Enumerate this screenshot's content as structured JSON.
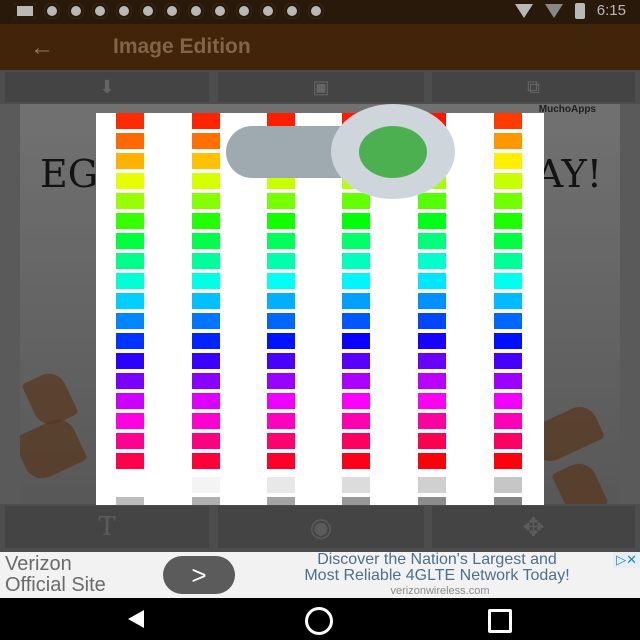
{
  "status": {
    "time": "6:15"
  },
  "appbar": {
    "title": "Image Edition"
  },
  "toolbar_top": {
    "buttons": [
      "download-icon",
      "image-add-icon",
      "share-icon"
    ]
  },
  "photo": {
    "watermark": "MuchoApps",
    "text_left": "EGG",
    "text_right": "AY!"
  },
  "toolbar_bottom": {
    "buttons": [
      "text-icon",
      "palette-icon",
      "move-icon"
    ]
  },
  "ad": {
    "title_line1": "Verizon",
    "title_line2": "Official Site",
    "arrow": ">",
    "text_line1": "Discover the Nation's Largest and",
    "text_line2": "Most Reliable 4GLTE Network Today!",
    "url": "verizonwireless.com",
    "adchoices": "▷✕"
  },
  "palette": {
    "columns": [
      [
        "#ff2b00",
        "#ff6a00",
        "#ffb300",
        "#e6ff00",
        "#98ff00",
        "#35ff00",
        "#00ff3c",
        "#00ff8a",
        "#00ffd5",
        "#00cfff",
        "#0086ff",
        "#0033ff",
        "#2a00ff",
        "#7a00ff",
        "#cc00ff",
        "#ff00e0",
        "#ff0090",
        "#ff004a"
      ],
      [
        "#ff2400",
        "#ff7000",
        "#ffc200",
        "#d6ff00",
        "#86ff00",
        "#23ff00",
        "#00ff4a",
        "#00ff9a",
        "#00ffe5",
        "#00c0ff",
        "#0076ff",
        "#0023ff",
        "#3900ff",
        "#8a00ff",
        "#dd00ff",
        "#ff00cf",
        "#ff0080",
        "#ff003a"
      ],
      [
        "#ff1e00",
        "#ff7a00",
        "#ffd000",
        "#c6ff00",
        "#75ff00",
        "#12ff00",
        "#00ff5a",
        "#00ffaa",
        "#00fff5",
        "#00b0ff",
        "#0066ff",
        "#0013ff",
        "#4900ff",
        "#9a00ff",
        "#ed00ff",
        "#ff00bf",
        "#ff0070",
        "#ff002a"
      ],
      [
        "#ff1a00",
        "#ff8400",
        "#ffdc00",
        "#b6ff00",
        "#64ff00",
        "#00ff08",
        "#00ff6a",
        "#00ffba",
        "#00f5ff",
        "#00a0ff",
        "#0056ff",
        "#0a00ff",
        "#5900ff",
        "#aa00ff",
        "#fc00ff",
        "#ff00af",
        "#ff0060",
        "#ff001a"
      ],
      [
        "#ff1400",
        "#ff8e00",
        "#ffe600",
        "#a6ff00",
        "#53ff00",
        "#00ff18",
        "#00ff7a",
        "#00ffca",
        "#00e6ff",
        "#0090ff",
        "#0046ff",
        "#1a00ff",
        "#6900ff",
        "#ba00ff",
        "#ff00f0",
        "#ff009f",
        "#ff0050",
        "#ff000a"
      ],
      [
        "#ff3b00",
        "#ff9800",
        "#fff000",
        "#c8ff00",
        "#72ff00",
        "#1cff00",
        "#00ff40",
        "#00ff96",
        "#00ffec",
        "#00bcff",
        "#0066ff",
        "#0010ff",
        "#4600ff",
        "#9c00ff",
        "#f200ff",
        "#ff00b8",
        "#ff0062",
        "#ff000c"
      ]
    ],
    "grays": [
      [
        "#ffffff",
        "#bdbdbd",
        "#7a7a7a",
        "#3a3a3a"
      ],
      [
        "#f4f4f4",
        "#b0b0b0",
        "#6e6e6e",
        "#2e2e2e"
      ],
      [
        "#e8e8e8",
        "#a4a4a4",
        "#626262",
        "#222222"
      ],
      [
        "#dcdcdc",
        "#989898",
        "#565656",
        "#161616"
      ],
      [
        "#d0d0d0",
        "#8c8c8c",
        "#4a4a4a",
        "#0a0a0a"
      ],
      [
        "#c6c6c6",
        "#828282",
        "#404040",
        "#000000"
      ]
    ]
  },
  "toggle": {
    "state": "on",
    "color": "#4caf50"
  }
}
